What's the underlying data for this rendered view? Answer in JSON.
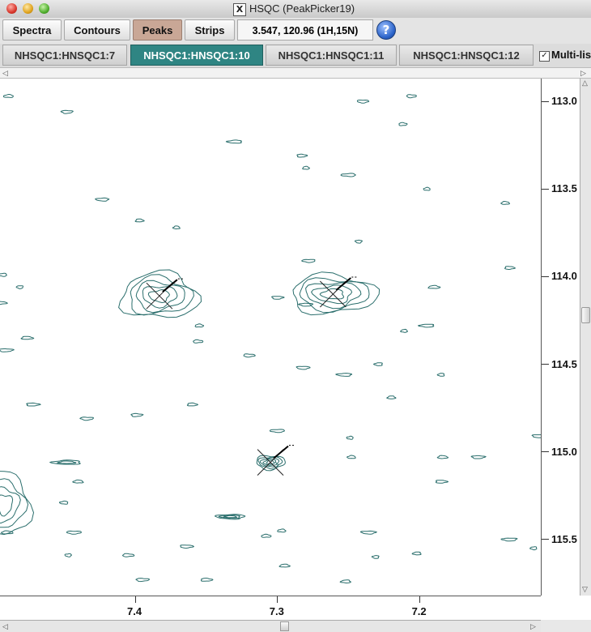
{
  "window": {
    "title": "HSQC (PeakPicker19)",
    "x_icon": "x11-icon"
  },
  "toolbar": {
    "spectra_label": "Spectra",
    "contours_label": "Contours",
    "peaks_label": "Peaks",
    "strips_label": "Strips",
    "cursor_readout": "3.547, 120.96 (1H,15N)",
    "help_label": "?"
  },
  "tabs": [
    {
      "label": "NHSQC1:HNSQC1:7",
      "active": false
    },
    {
      "label": "NHSQC1:HNSQC1:10",
      "active": true
    },
    {
      "label": "NHSQC1:HNSQC1:11",
      "active": false
    },
    {
      "label": "NHSQC1:HNSQC1:12",
      "active": false
    }
  ],
  "multilist": {
    "label": "Multi-list",
    "checked": true,
    "check_glyph": "✓"
  },
  "colors": {
    "contour": "#2a6e6c",
    "active_tab": "#2f8583",
    "peaks_button": "#c9a796"
  },
  "chart_data": {
    "type": "contour",
    "xlabel": "",
    "ylabel": "",
    "x_ticks": [
      7.4,
      7.3,
      7.2
    ],
    "x_tick_labels": [
      "7.4",
      "7.3",
      "7.2"
    ],
    "y_ticks": [
      113.0,
      113.5,
      114.0,
      114.5,
      115.0,
      115.5
    ],
    "y_tick_labels": [
      "113.0",
      "113.5",
      "114.0",
      "114.5",
      "115.0",
      "115.5"
    ],
    "xlim": [
      7.495,
      7.115
    ],
    "ylim": [
      112.87,
      115.82
    ],
    "x_reversed": true,
    "peaks": [
      {
        "x": 7.383,
        "y": 114.11,
        "rx": 0.027,
        "ry": 0.13,
        "levels": 5
      },
      {
        "x": 7.261,
        "y": 114.1,
        "rx": 0.03,
        "ry": 0.11,
        "levels": 5
      },
      {
        "x": 7.305,
        "y": 115.06,
        "rx": 0.01,
        "ry": 0.04,
        "levels": 5
      },
      {
        "x": 7.333,
        "y": 115.37,
        "rx": 0.01,
        "ry": 0.013,
        "levels": 3
      },
      {
        "x": 7.448,
        "y": 115.06,
        "rx": 0.01,
        "ry": 0.012,
        "levels": 2
      },
      {
        "x": 7.492,
        "y": 115.3,
        "rx": 0.018,
        "ry": 0.18,
        "levels": 4
      }
    ],
    "noise": [
      [
        7.28,
        113.38
      ],
      [
        7.212,
        113.13
      ],
      [
        7.206,
        112.97
      ],
      [
        7.24,
        113.0
      ],
      [
        7.423,
        113.56
      ],
      [
        7.33,
        113.23
      ],
      [
        7.371,
        113.72
      ],
      [
        7.397,
        113.68
      ],
      [
        7.283,
        113.31
      ],
      [
        7.448,
        113.06
      ],
      [
        7.278,
        113.91
      ],
      [
        7.25,
        113.42
      ],
      [
        7.195,
        113.5
      ],
      [
        7.14,
        113.58
      ],
      [
        7.137,
        113.95
      ],
      [
        7.3,
        114.12
      ],
      [
        7.28,
        114.16
      ],
      [
        7.195,
        114.28
      ],
      [
        7.211,
        114.31
      ],
      [
        7.355,
        114.28
      ],
      [
        7.356,
        114.37
      ],
      [
        7.32,
        114.45
      ],
      [
        7.282,
        114.52
      ],
      [
        7.253,
        114.56
      ],
      [
        7.185,
        114.56
      ],
      [
        7.22,
        114.69
      ],
      [
        7.36,
        114.73
      ],
      [
        7.399,
        114.79
      ],
      [
        7.434,
        114.81
      ],
      [
        7.3,
        114.88
      ],
      [
        7.249,
        114.92
      ],
      [
        7.248,
        115.03
      ],
      [
        7.184,
        115.03
      ],
      [
        7.185,
        115.17
      ],
      [
        7.159,
        115.03
      ],
      [
        7.137,
        115.5
      ],
      [
        7.12,
        115.55
      ],
      [
        7.297,
        115.45
      ],
      [
        7.308,
        115.48
      ],
      [
        7.405,
        115.59
      ],
      [
        7.364,
        115.54
      ],
      [
        7.236,
        115.46
      ],
      [
        7.231,
        115.6
      ],
      [
        7.202,
        115.58
      ],
      [
        7.295,
        115.65
      ],
      [
        7.35,
        115.73
      ],
      [
        7.395,
        115.73
      ],
      [
        7.443,
        115.46
      ],
      [
        7.447,
        115.59
      ],
      [
        7.45,
        115.29
      ],
      [
        7.44,
        115.17
      ],
      [
        7.476,
        114.35
      ],
      [
        7.472,
        114.73
      ],
      [
        7.491,
        114.42
      ],
      [
        7.481,
        114.06
      ],
      [
        7.493,
        113.99
      ],
      [
        7.489,
        112.97
      ],
      [
        7.49,
        115.46
      ],
      [
        7.495,
        114.15
      ],
      [
        7.116,
        114.91
      ],
      [
        7.243,
        113.8
      ],
      [
        7.229,
        114.5
      ],
      [
        7.252,
        115.74
      ],
      [
        7.19,
        114.06
      ]
    ],
    "peak_markers": [
      {
        "x": 7.383,
        "y": 114.11
      },
      {
        "x": 7.261,
        "y": 114.1
      },
      {
        "x": 7.305,
        "y": 115.06
      }
    ]
  }
}
